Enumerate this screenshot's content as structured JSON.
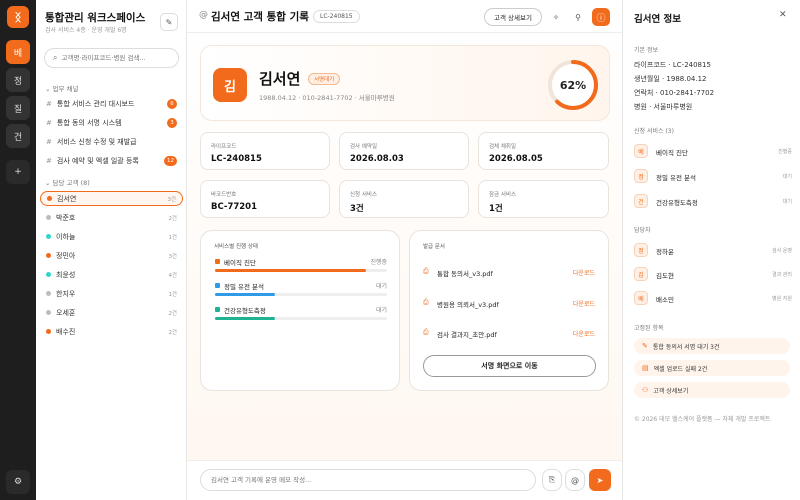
{
  "rail": {
    "logo": "ᛝ",
    "items": [
      "베",
      "정",
      "질",
      "건"
    ],
    "add": "+",
    "settings": "⚙"
  },
  "sidebar": {
    "title": "통합관리 워크스페이스",
    "subtitle": "검사 서비스 4종 · 운영 개발 6명",
    "search_placeholder": "고객명·라이프코드·병원 검색...",
    "channels_heading": "업무 채널",
    "channels": [
      {
        "label": "통합 서비스 관리 대시보드",
        "badge": "6"
      },
      {
        "label": "통합 동의 서명 시스템",
        "badge": "3"
      },
      {
        "label": "서비스 신청 수정 및 재발급",
        "badge": ""
      },
      {
        "label": "검사 예약 및 엑셀 일괄 등록",
        "badge": "12"
      }
    ],
    "customers_heading": "담당 고객 (8)",
    "customers": [
      {
        "name": "김서연",
        "count": "3건",
        "color": "#f26a1b"
      },
      {
        "name": "박준호",
        "count": "2건",
        "color": "#bdbdbd"
      },
      {
        "name": "이하늘",
        "count": "1건",
        "color": "#2fd6c5"
      },
      {
        "name": "정민아",
        "count": "3건",
        "color": "#f26a1b"
      },
      {
        "name": "최윤성",
        "count": "4건",
        "color": "#2fd6c5"
      },
      {
        "name": "한지우",
        "count": "1건",
        "color": "#bdbdbd"
      },
      {
        "name": "오세훈",
        "count": "2건",
        "color": "#bdbdbd"
      },
      {
        "name": "배수진",
        "count": "2건",
        "color": "#f26a1b"
      }
    ]
  },
  "topbar": {
    "title": "김서연 고객 통합 기록",
    "code": "LC-240815",
    "detail_button": "고객 상세보기"
  },
  "hero": {
    "avatar": "김",
    "name": "김서연",
    "tag": "서명대기",
    "meta": "1988.04.12 · 010-2841-7702 · 서울마루병원",
    "progress_label": "62%",
    "progress": 0.62
  },
  "info_cards": [
    {
      "label": "라이프코드",
      "value": "LC-240815"
    },
    {
      "label": "검사 예약일",
      "value": "2026.08.03"
    },
    {
      "label": "검체 채취일",
      "value": "2026.08.05"
    },
    {
      "label": "바코드번호",
      "value": "BC-77201"
    },
    {
      "label": "신청 서비스",
      "value": "3건"
    },
    {
      "label": "잠금 서비스",
      "value": "1건"
    }
  ],
  "services_panel": {
    "title": "서비스별 진행 상태",
    "items": [
      {
        "name": "베이직 진단",
        "status": "진행중",
        "progress": 0.88,
        "color": "#f26a1b"
      },
      {
        "name": "정밀 유전 분석",
        "status": "대기",
        "progress": 0.35,
        "color": "#2f9be6"
      },
      {
        "name": "건강유형도측정",
        "status": "대기",
        "progress": 0.35,
        "color": "#1fb394"
      }
    ]
  },
  "docs_panel": {
    "title": "발급 문서",
    "download_label": "다운로드",
    "docs": [
      "통합 동의서_v3.pdf",
      "병원용 의뢰서_v3.pdf",
      "검사 결과지_초안.pdf"
    ],
    "sign_button": "서명 화면으로 이동"
  },
  "composer": {
    "placeholder": "김서연 고객 기록에 운영 메모 작성..."
  },
  "right": {
    "title": "김서연 정보",
    "basic_heading": "기본 정보",
    "basic": [
      "라이프코드 · LC-240815",
      "생년월일 · 1988.04.12",
      "연락처 · 010-2841-7702",
      "병원 · 서울마루병원"
    ],
    "services_heading": "신청 서비스 (3)",
    "services": [
      {
        "avatar": "베",
        "name": "베이직 진단",
        "status": "진행중"
      },
      {
        "avatar": "정",
        "name": "정밀 유전 분석",
        "status": "대기"
      },
      {
        "avatar": "건",
        "name": "건강유형도측정",
        "status": "대기"
      }
    ],
    "staff_heading": "담당자",
    "staff": [
      {
        "avatar": "정",
        "name": "정하윤",
        "role": "검사 운영"
      },
      {
        "avatar": "김",
        "name": "김도현",
        "role": "결과 관리"
      },
      {
        "avatar": "배",
        "name": "배소민",
        "role": "병원 지원"
      }
    ],
    "actions_heading": "고정된 항목",
    "actions": [
      {
        "icon": "✎",
        "label": "통합 동의서 서명 대기 3건"
      },
      {
        "icon": "▤",
        "label": "엑셀 업로드 실패 2건"
      },
      {
        "icon": "⚇",
        "label": "고객 상세보기"
      }
    ],
    "footer": "© 2026 데모 헬스케어 플랫폼 — 자체 개발 프로젝트"
  }
}
